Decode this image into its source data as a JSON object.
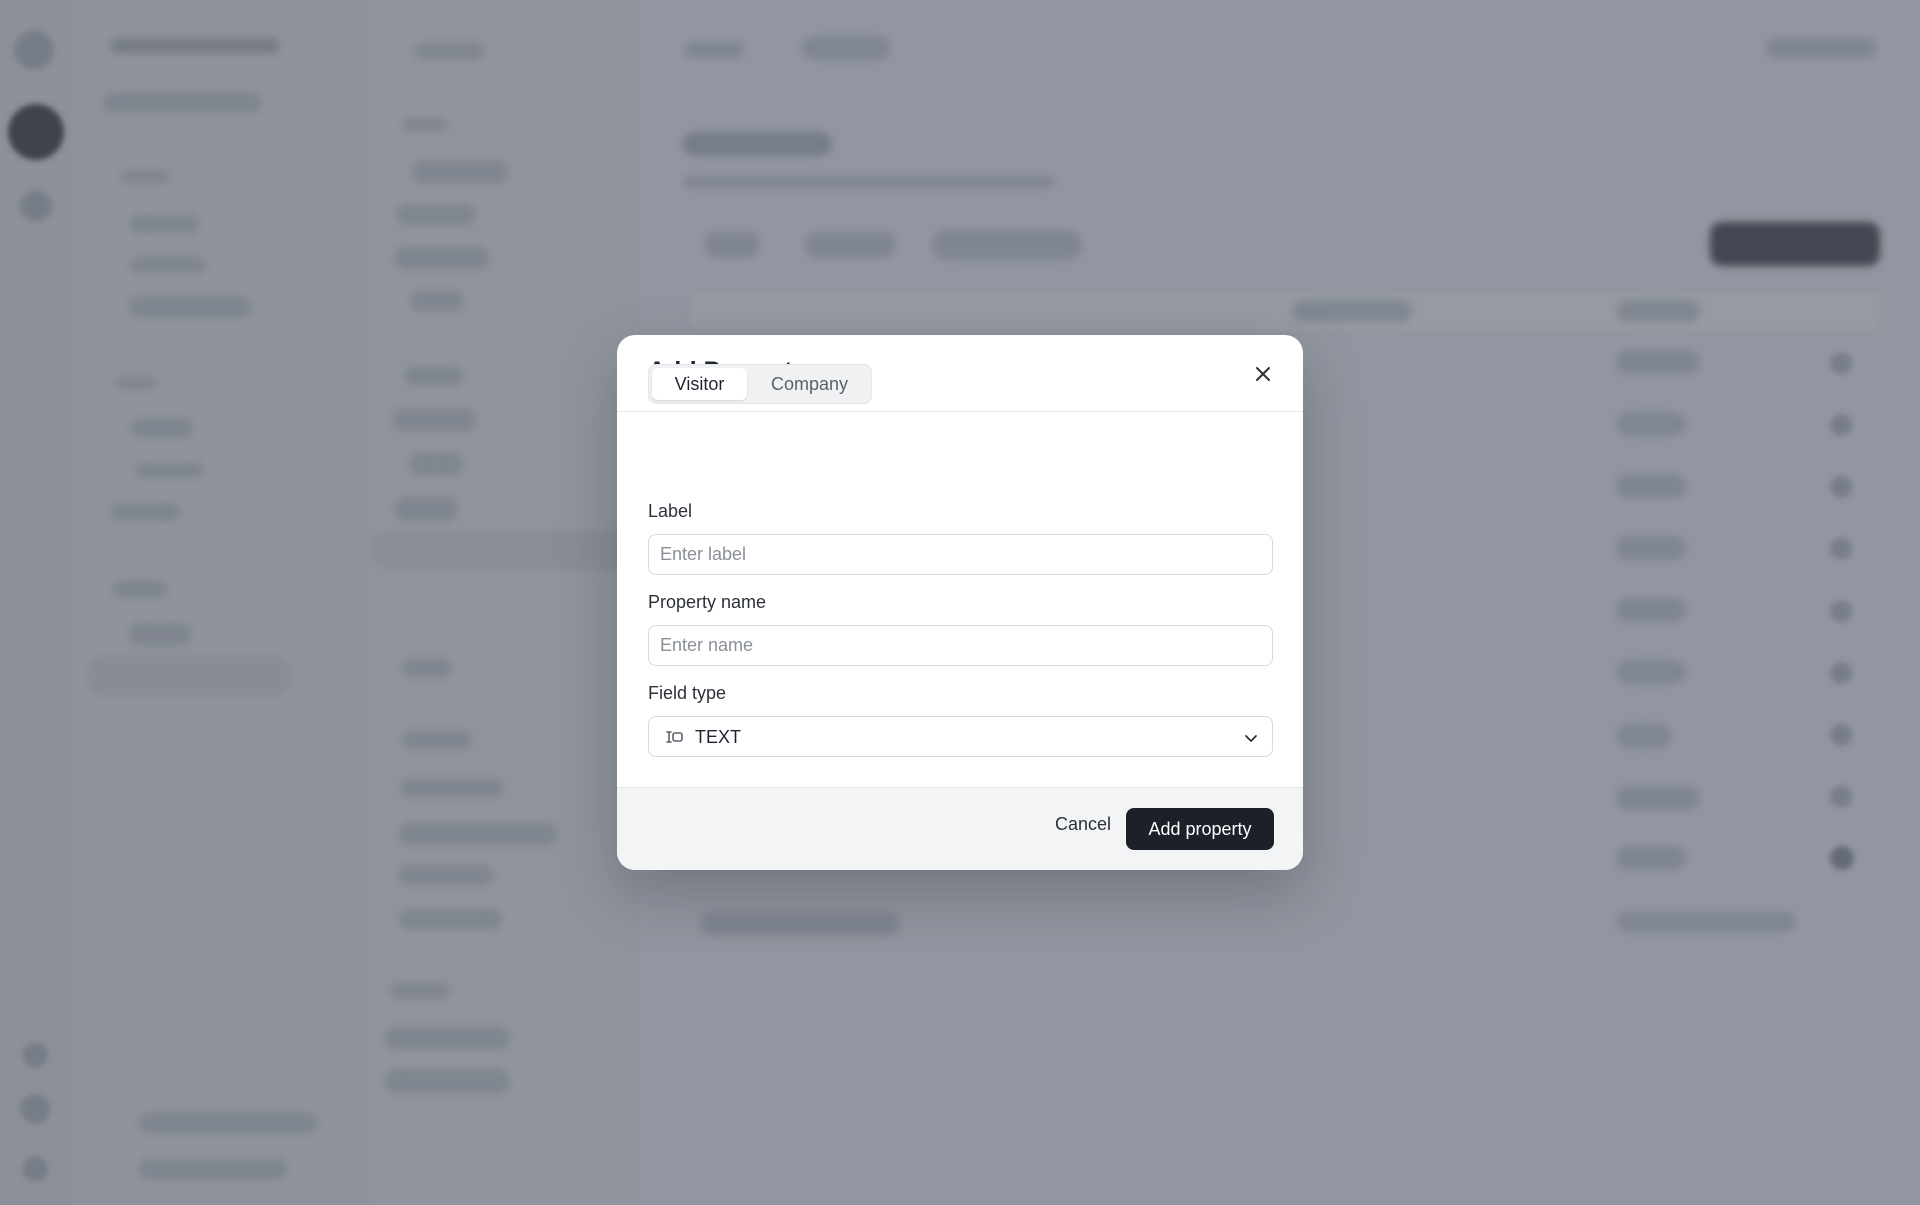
{
  "modal": {
    "title": "Add Property",
    "close_icon": "close-icon",
    "tabs": [
      {
        "label": "Visitor",
        "active": true
      },
      {
        "label": "Company",
        "active": false
      }
    ],
    "fields": {
      "label": {
        "label": "Label",
        "value": "",
        "placeholder": "Enter label"
      },
      "property_name": {
        "label": "Property name",
        "value": "",
        "placeholder": "Enter name"
      },
      "field_type": {
        "label": "Field type",
        "selected": "TEXT",
        "icon": "text-cursor-icon"
      }
    },
    "footer": {
      "cancel_label": "Cancel",
      "submit_label": "Add property"
    }
  },
  "colors": {
    "overlay": "#8f949c",
    "primary_button": "#1b2029",
    "modal_bg": "#ffffff",
    "footer_bg": "#f3f4f6"
  }
}
